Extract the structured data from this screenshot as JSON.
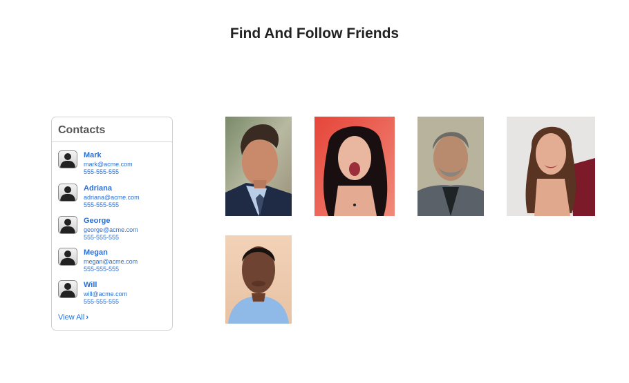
{
  "page": {
    "title": "Find And Follow Friends"
  },
  "contacts": {
    "header": "Contacts",
    "items": [
      {
        "name": "Mark",
        "email": "mark@acme.com",
        "phone": "555-555-555"
      },
      {
        "name": "Adriana",
        "email": "adriana@acme.com",
        "phone": "555-555-555"
      },
      {
        "name": "George",
        "email": "george@acme.com",
        "phone": "555-555-555"
      },
      {
        "name": "Megan",
        "email": "megan@acme.com",
        "phone": "555-555-555"
      },
      {
        "name": "Will",
        "email": "will@acme.com",
        "phone": "555-555-555"
      }
    ],
    "view_all": "View All",
    "view_all_icon": "chevron-right-icon",
    "avatar_icon": "person-silhouette-icon"
  },
  "photos": {
    "icon": "person-photo",
    "colors": {
      "link": "#2a6fd6"
    }
  }
}
